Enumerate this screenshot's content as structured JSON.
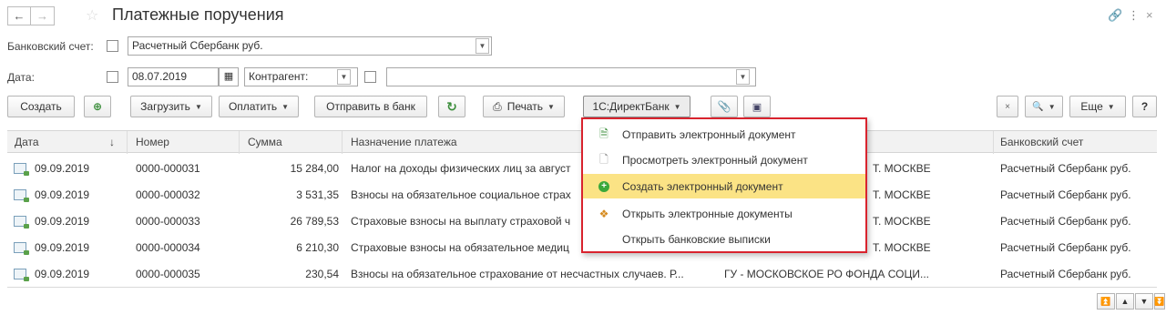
{
  "header": {
    "title": "Платежные поручения",
    "back_glyph": "←",
    "forward_glyph": "→",
    "star_glyph": "☆",
    "link_glyph": "🔗",
    "more_glyph": "⋮",
    "close_glyph": "×"
  },
  "filters": {
    "bank_account_label": "Банковский счет:",
    "bank_account_value": "Расчетный Сбербанк руб.",
    "date_label": "Дата:",
    "date_value": "08.07.2019",
    "counterparty_label": "Контрагент:",
    "counterparty_value": ""
  },
  "toolbar": {
    "create": "Создать",
    "load": "Загрузить",
    "pay": "Оплатить",
    "send_to_bank": "Отправить в банк",
    "print": "Печать",
    "directbank": "1С:ДиректБанк",
    "more": "Еще",
    "help": "?",
    "clear_glyph": "×",
    "search_glyph": "🔍"
  },
  "table": {
    "columns": {
      "date": "Дата",
      "sort_glyph": "↓",
      "number": "Номер",
      "amount": "Сумма",
      "purpose": "Назначение платежа",
      "bank_account": "Банковский счет"
    },
    "rows": [
      {
        "date": "09.09.2019",
        "number": "0000-000031",
        "amount": "15 284,00",
        "purpose": "Налог на доходы физических лиц за август",
        "recipient": "Т. МОСКВЕ",
        "bank_account": "Расчетный Сбербанк руб."
      },
      {
        "date": "09.09.2019",
        "number": "0000-000032",
        "amount": "3 531,35",
        "purpose": "Взносы на обязательное социальное страх",
        "recipient": "Т. МОСКВЕ",
        "bank_account": "Расчетный Сбербанк руб."
      },
      {
        "date": "09.09.2019",
        "number": "0000-000033",
        "amount": "26 789,53",
        "purpose": "Страховые взносы на выплату страховой ч",
        "recipient": "Т. МОСКВЕ",
        "bank_account": "Расчетный Сбербанк руб."
      },
      {
        "date": "09.09.2019",
        "number": "0000-000034",
        "amount": "6 210,30",
        "purpose": "Страховые взносы на обязательное медиц",
        "recipient": "Т. МОСКВЕ",
        "bank_account": "Расчетный Сбербанк руб."
      },
      {
        "date": "09.09.2019",
        "number": "0000-000035",
        "amount": "230,54",
        "purpose": "Взносы на обязательное страхование от несчастных случаев. Р...",
        "recipient": "ГУ - МОСКОВСКОЕ РО ФОНДА СОЦИ...",
        "bank_account": "Расчетный Сбербанк руб."
      }
    ]
  },
  "menu": {
    "items": [
      {
        "label": "Отправить электронный документ",
        "icon": "send-document-icon"
      },
      {
        "label": "Просмотреть электронный документ",
        "icon": "document-icon"
      },
      {
        "label": "Создать электронный документ",
        "icon": "add-circle-icon"
      },
      {
        "label": "Открыть электронные документы",
        "icon": "documents-stack-icon"
      },
      {
        "label": "Открыть банковские выписки",
        "icon": ""
      }
    ]
  },
  "colors": {
    "menu_border": "#d9232e",
    "menu_highlight": "#fbe385",
    "add_icon": "#3aa83a"
  }
}
